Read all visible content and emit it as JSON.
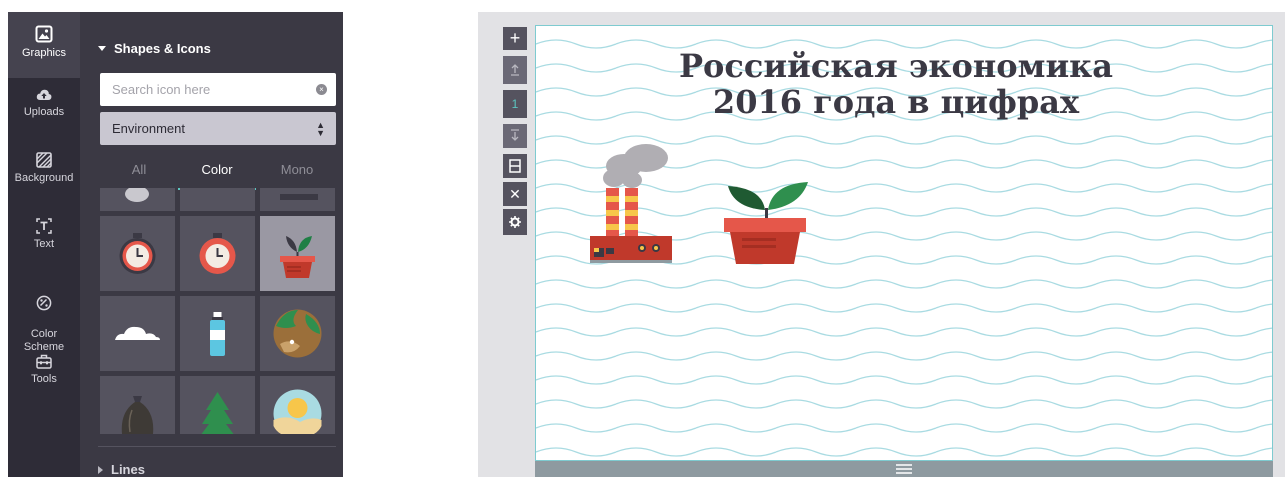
{
  "sidebar": {
    "items": [
      {
        "label": "Graphics",
        "icon": "image-icon"
      },
      {
        "label": "Uploads",
        "icon": "cloud-upload-icon"
      },
      {
        "label": "Background",
        "icon": "background-pattern-icon"
      },
      {
        "label": "Text",
        "icon": "text-icon"
      },
      {
        "label": "Color\nScheme",
        "icon": "palette-icon"
      },
      {
        "label": "Tools",
        "icon": "toolbox-icon"
      }
    ]
  },
  "panel": {
    "section_title": "Shapes & Icons",
    "search_placeholder": "Search icon here",
    "category": "Environment",
    "tabs": [
      "All",
      "Color",
      "Mono"
    ],
    "active_tab": "Color",
    "icons": [
      "stopwatch-icon",
      "stopwatch-icon",
      "plant-pot-icon",
      "cloud-icon",
      "water-bottle-icon",
      "globe-icon",
      "trash-bag-icon",
      "pine-tree-icon",
      "sun-landscape-icon"
    ],
    "lines_title": "Lines"
  },
  "toolbar": {
    "add": "+",
    "page_number": "1",
    "delete": "✕"
  },
  "canvas": {
    "title_line1": "Российская экономика",
    "title_line2": "2016 года в цифрах"
  },
  "colors": {
    "rail_bg": "#2e2c37",
    "panel_bg": "#3b3944",
    "accent": "#5cc6c1",
    "wave": "#a9dbe2",
    "title": "#3b3944"
  }
}
